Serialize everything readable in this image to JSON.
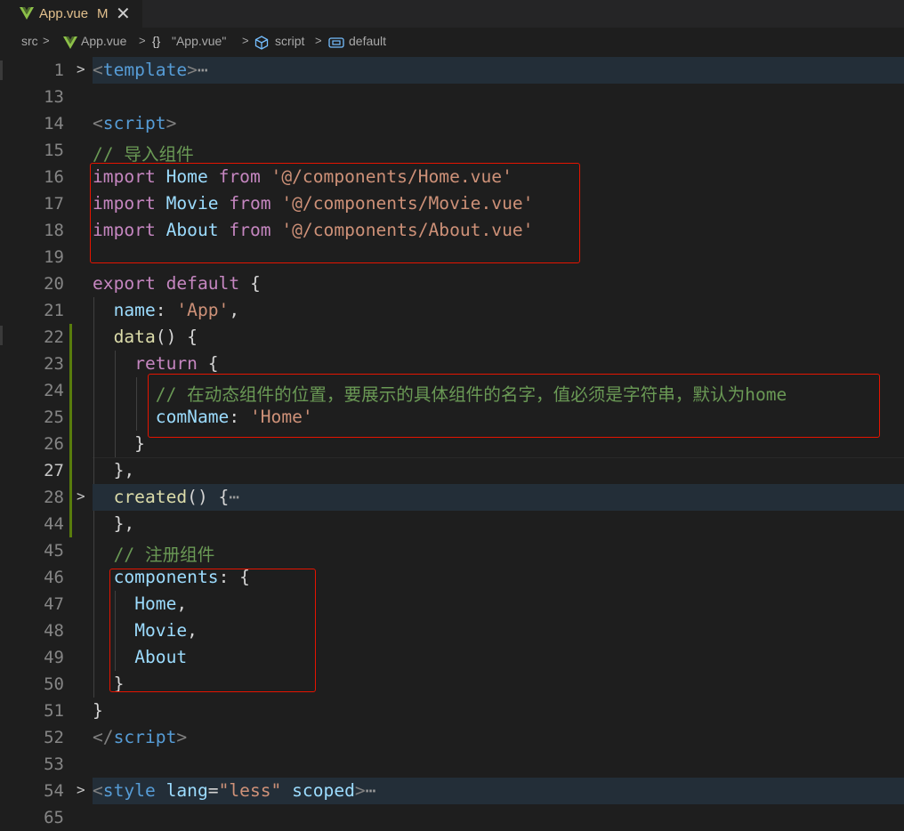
{
  "tab": {
    "filename": "App.vue",
    "modified": "M",
    "close": "✕"
  },
  "breadcrumb": {
    "src": "src",
    "file": "App.vue",
    "obj": "\"App.vue\"",
    "script": "script",
    "def": "default"
  },
  "lines": {
    "l1": {
      "num": "1",
      "p1": "<",
      "p2": "template",
      "p3": ">",
      "p4": "⋯"
    },
    "l13": {
      "num": "13"
    },
    "l14": {
      "num": "14",
      "p1": "<",
      "p2": "script",
      "p3": ">"
    },
    "l15": {
      "num": "15",
      "p1": "// 导入组件"
    },
    "l16": {
      "num": "16",
      "p1": "import",
      "p2": " ",
      "p3": "Home",
      "p4": " ",
      "p5": "from",
      "p6": " ",
      "p7": "'@/components/Home.vue'"
    },
    "l17": {
      "num": "17",
      "p1": "import",
      "p2": " ",
      "p3": "Movie",
      "p4": " ",
      "p5": "from",
      "p6": " ",
      "p7": "'@/components/Movie.vue'"
    },
    "l18": {
      "num": "18",
      "p1": "import",
      "p2": " ",
      "p3": "About",
      "p4": " ",
      "p5": "from",
      "p6": " ",
      "p7": "'@/components/About.vue'"
    },
    "l19": {
      "num": "19"
    },
    "l20": {
      "num": "20",
      "p1": "export",
      "p2": " ",
      "p3": "default",
      "p4": " {"
    },
    "l21": {
      "num": "21",
      "p1": "  ",
      "p2": "name",
      "p3": ": ",
      "p4": "'App'",
      "p5": ","
    },
    "l22": {
      "num": "22",
      "p1": "  ",
      "p2": "data",
      "p3": "() {"
    },
    "l23": {
      "num": "23",
      "p1": "    ",
      "p2": "return",
      "p3": " {"
    },
    "l24": {
      "num": "24",
      "p1": "      ",
      "p2": "// 在动态组件的位置，要展示的具体组件的名字，值必须是字符串，默认为home"
    },
    "l25": {
      "num": "25",
      "p1": "      ",
      "p2": "comName",
      "p3": ": ",
      "p4": "'Home'"
    },
    "l26": {
      "num": "26",
      "p1": "    }"
    },
    "l27": {
      "num": "27",
      "p1": "  },"
    },
    "l28": {
      "num": "28",
      "p1": "  ",
      "p2": "created",
      "p3": "() {",
      "p4": "⋯"
    },
    "l44": {
      "num": "44",
      "p1": "  },"
    },
    "l45": {
      "num": "45",
      "p1": "  ",
      "p2": "// 注册组件"
    },
    "l46": {
      "num": "46",
      "p1": "  ",
      "p2": "components",
      "p3": ": {"
    },
    "l47": {
      "num": "47",
      "p1": "    ",
      "p2": "Home",
      "p3": ","
    },
    "l48": {
      "num": "48",
      "p1": "    ",
      "p2": "Movie",
      "p3": ","
    },
    "l49": {
      "num": "49",
      "p1": "    ",
      "p2": "About"
    },
    "l50": {
      "num": "50",
      "p1": "  }"
    },
    "l51": {
      "num": "51",
      "p1": "}"
    },
    "l52": {
      "num": "52",
      "p1": "</",
      "p2": "script",
      "p3": ">"
    },
    "l53": {
      "num": "53"
    },
    "l54": {
      "num": "54",
      "p1": "<",
      "p2": "style",
      "p3": " ",
      "p4": "lang",
      "p5": "=",
      "p6": "\"less\"",
      "p7": " ",
      "p8": "scoped",
      "p9": ">",
      "p10": "⋯"
    },
    "l65": {
      "num": "65"
    }
  },
  "colors": {
    "keyword": "#c586c0",
    "string": "#ce9178",
    "comment": "#6a9955",
    "variable": "#9cdcfe",
    "tag": "#569cd6",
    "annotation_box": "#e51400"
  },
  "icons": {
    "fold_collapsed": "chevron-right-icon",
    "vue_file": "vue-logo-icon"
  }
}
